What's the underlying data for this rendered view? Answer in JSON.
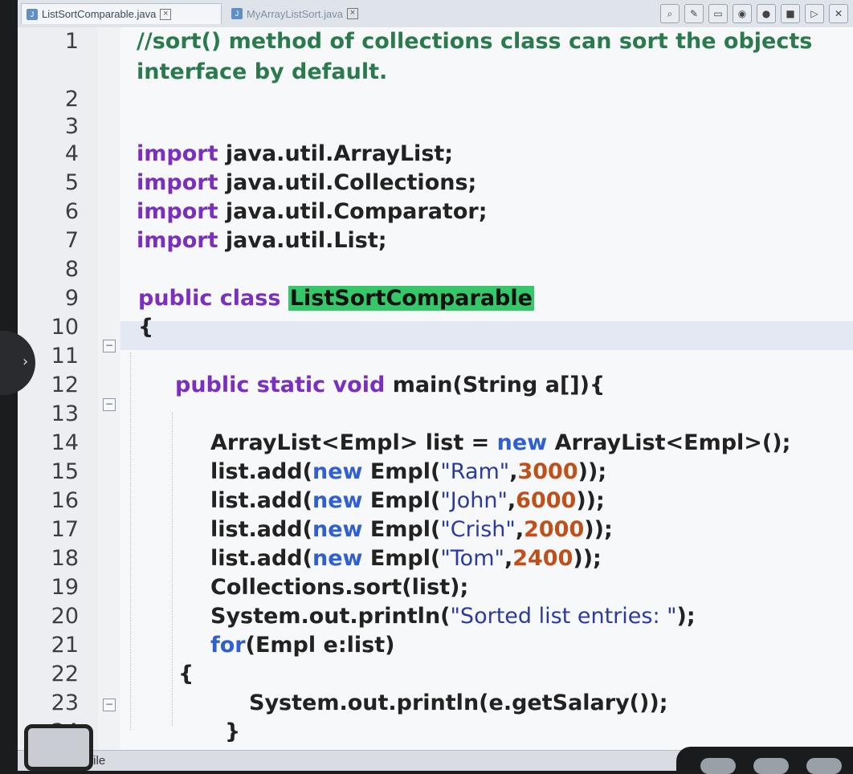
{
  "tabs": [
    {
      "label": "ListSortComparable.java",
      "active": true
    },
    {
      "label": "MyArrayListSort.java",
      "active": false
    }
  ],
  "toolbar": {
    "icons": [
      "search-icon",
      "edit-icon",
      "image-icon",
      "eye-icon",
      "record-icon",
      "stop-icon",
      "play-icon",
      "close-icon"
    ]
  },
  "editor": {
    "lines": [
      {
        "num": "1",
        "segments": [
          {
            "t": "//sort() method of collections class can sort the objects",
            "c": "cm"
          }
        ]
      },
      {
        "num": "",
        "segments": [
          {
            "t": "interface by default.",
            "c": "cm"
          }
        ]
      },
      {
        "num": "2",
        "segments": []
      },
      {
        "num": "3",
        "segments": []
      },
      {
        "num": "4",
        "segments": [
          {
            "t": "import ",
            "c": "kw"
          },
          {
            "t": "java.util.ArrayList;",
            "c": ""
          }
        ]
      },
      {
        "num": "5",
        "segments": [
          {
            "t": "import ",
            "c": "kw"
          },
          {
            "t": "java.util.Collections;",
            "c": ""
          }
        ]
      },
      {
        "num": "6",
        "segments": [
          {
            "t": "import ",
            "c": "kw"
          },
          {
            "t": "java.util.Comparator;",
            "c": ""
          }
        ]
      },
      {
        "num": "7",
        "segments": [
          {
            "t": "import ",
            "c": "kw"
          },
          {
            "t": "java.util.List;",
            "c": ""
          }
        ]
      },
      {
        "num": "8",
        "segments": []
      },
      {
        "num": "9",
        "segments": [
          {
            "t": "public class ",
            "c": "kw"
          },
          {
            "t": "ListSortComparable",
            "c": "hl"
          }
        ]
      },
      {
        "num": "10",
        "segments": [
          {
            "t": "{",
            "c": ""
          }
        ]
      },
      {
        "num": "11",
        "segments": []
      },
      {
        "num": "12",
        "segments": [
          {
            "t": "public static void ",
            "c": "kw"
          },
          {
            "t": "main(String a[]){",
            "c": ""
          }
        ]
      },
      {
        "num": "13",
        "segments": []
      },
      {
        "num": "14",
        "segments": [
          {
            "t": "ArrayList<Empl> list = ",
            "c": ""
          },
          {
            "t": "new ",
            "c": "kwb"
          },
          {
            "t": "ArrayList<Empl>();",
            "c": ""
          }
        ]
      },
      {
        "num": "15",
        "segments": [
          {
            "t": "list.add(",
            "c": ""
          },
          {
            "t": "new ",
            "c": "kwb"
          },
          {
            "t": "Empl(",
            "c": ""
          },
          {
            "t": "\"Ram\"",
            "c": "str"
          },
          {
            "t": ",",
            "c": ""
          },
          {
            "t": "3000",
            "c": "num"
          },
          {
            "t": "));",
            "c": ""
          }
        ]
      },
      {
        "num": "16",
        "segments": [
          {
            "t": "list.add(",
            "c": ""
          },
          {
            "t": "new ",
            "c": "kwb"
          },
          {
            "t": "Empl(",
            "c": ""
          },
          {
            "t": "\"John\"",
            "c": "str"
          },
          {
            "t": ",",
            "c": ""
          },
          {
            "t": "6000",
            "c": "num"
          },
          {
            "t": "));",
            "c": ""
          }
        ]
      },
      {
        "num": "17",
        "segments": [
          {
            "t": "list.add(",
            "c": ""
          },
          {
            "t": "new ",
            "c": "kwb"
          },
          {
            "t": "Empl(",
            "c": ""
          },
          {
            "t": "\"Crish\"",
            "c": "str"
          },
          {
            "t": ",",
            "c": ""
          },
          {
            "t": "2000",
            "c": "num"
          },
          {
            "t": "));",
            "c": ""
          }
        ]
      },
      {
        "num": "18",
        "segments": [
          {
            "t": "list.add(",
            "c": ""
          },
          {
            "t": "new ",
            "c": "kwb"
          },
          {
            "t": "Empl(",
            "c": ""
          },
          {
            "t": "\"Tom\"",
            "c": "str"
          },
          {
            "t": ",",
            "c": ""
          },
          {
            "t": "2400",
            "c": "num"
          },
          {
            "t": "));",
            "c": ""
          }
        ]
      },
      {
        "num": "19",
        "segments": [
          {
            "t": "Collections.sort(list);",
            "c": ""
          }
        ]
      },
      {
        "num": "20",
        "segments": [
          {
            "t": "System.out.println(",
            "c": ""
          },
          {
            "t": "\"Sorted list entries: \"",
            "c": "str"
          },
          {
            "t": ");",
            "c": ""
          }
        ]
      },
      {
        "num": "21",
        "segments": [
          {
            "t": "for",
            "c": "kwb"
          },
          {
            "t": "(Empl e:list)",
            "c": ""
          }
        ]
      },
      {
        "num": "22",
        "segments": [
          {
            "t": "{",
            "c": ""
          }
        ]
      },
      {
        "num": "23",
        "segments": [
          {
            "t": "System.out.println(e.getSalary());",
            "c": ""
          }
        ]
      },
      {
        "num": "24",
        "segments": [
          {
            "t": "}",
            "c": ""
          }
        ]
      }
    ]
  },
  "status": {
    "text": "file"
  }
}
